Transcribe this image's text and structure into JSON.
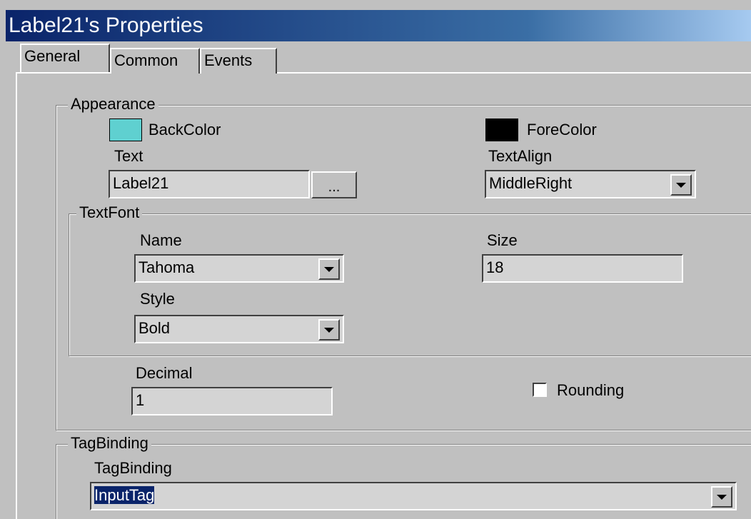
{
  "window": {
    "title": "Label21's Properties"
  },
  "tabs": [
    {
      "label": "General"
    },
    {
      "label": "Common"
    },
    {
      "label": "Events"
    }
  ],
  "appearance": {
    "group_title": "Appearance",
    "back_color": {
      "label": "BackColor",
      "value": "#5fd0d0"
    },
    "fore_color": {
      "label": "ForeColor",
      "value": "#000000"
    },
    "text": {
      "label": "Text",
      "value": "Label21",
      "browse_label": "..."
    },
    "text_align": {
      "label": "TextAlign",
      "value": "MiddleRight"
    }
  },
  "text_font": {
    "group_title": "TextFont",
    "name": {
      "label": "Name",
      "value": "Tahoma"
    },
    "size": {
      "label": "Size",
      "value": "18"
    },
    "style": {
      "label": "Style",
      "value": "Bold"
    }
  },
  "decimal": {
    "label": "Decimal",
    "value": "1"
  },
  "rounding": {
    "label": "Rounding",
    "checked": false
  },
  "tag_binding": {
    "group_title": "TagBinding",
    "label": "TagBinding",
    "value": "InputTag"
  }
}
